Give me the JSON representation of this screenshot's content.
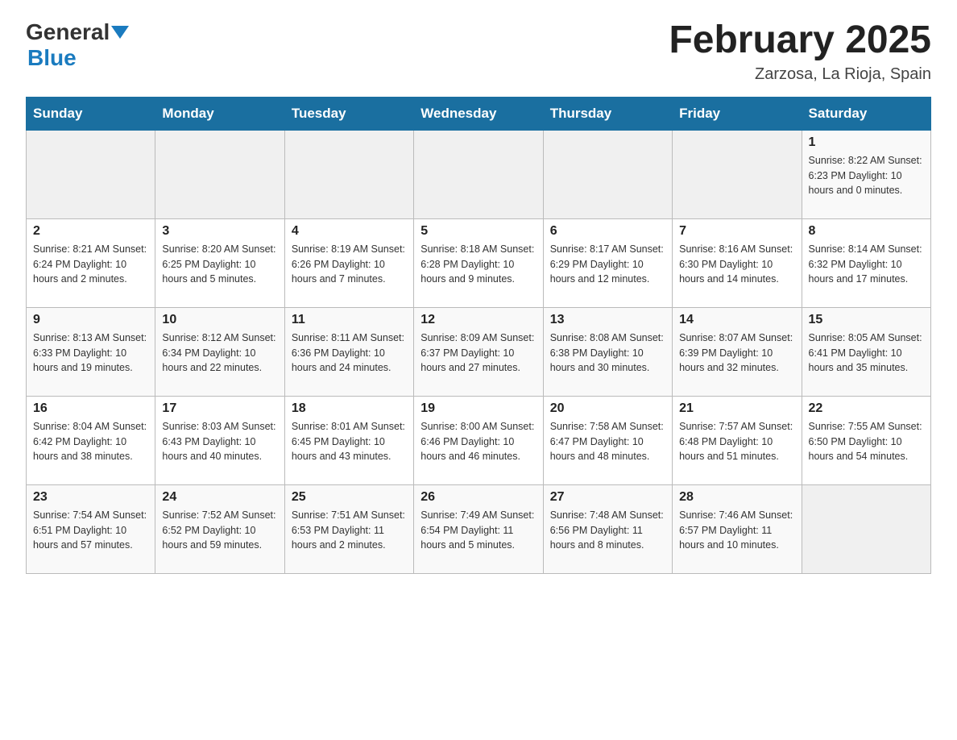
{
  "header": {
    "logo_general": "General",
    "logo_blue": "Blue",
    "title": "February 2025",
    "subtitle": "Zarzosa, La Rioja, Spain"
  },
  "weekdays": [
    "Sunday",
    "Monday",
    "Tuesday",
    "Wednesday",
    "Thursday",
    "Friday",
    "Saturday"
  ],
  "weeks": [
    [
      {
        "day": "",
        "info": ""
      },
      {
        "day": "",
        "info": ""
      },
      {
        "day": "",
        "info": ""
      },
      {
        "day": "",
        "info": ""
      },
      {
        "day": "",
        "info": ""
      },
      {
        "day": "",
        "info": ""
      },
      {
        "day": "1",
        "info": "Sunrise: 8:22 AM\nSunset: 6:23 PM\nDaylight: 10 hours\nand 0 minutes."
      }
    ],
    [
      {
        "day": "2",
        "info": "Sunrise: 8:21 AM\nSunset: 6:24 PM\nDaylight: 10 hours\nand 2 minutes."
      },
      {
        "day": "3",
        "info": "Sunrise: 8:20 AM\nSunset: 6:25 PM\nDaylight: 10 hours\nand 5 minutes."
      },
      {
        "day": "4",
        "info": "Sunrise: 8:19 AM\nSunset: 6:26 PM\nDaylight: 10 hours\nand 7 minutes."
      },
      {
        "day": "5",
        "info": "Sunrise: 8:18 AM\nSunset: 6:28 PM\nDaylight: 10 hours\nand 9 minutes."
      },
      {
        "day": "6",
        "info": "Sunrise: 8:17 AM\nSunset: 6:29 PM\nDaylight: 10 hours\nand 12 minutes."
      },
      {
        "day": "7",
        "info": "Sunrise: 8:16 AM\nSunset: 6:30 PM\nDaylight: 10 hours\nand 14 minutes."
      },
      {
        "day": "8",
        "info": "Sunrise: 8:14 AM\nSunset: 6:32 PM\nDaylight: 10 hours\nand 17 minutes."
      }
    ],
    [
      {
        "day": "9",
        "info": "Sunrise: 8:13 AM\nSunset: 6:33 PM\nDaylight: 10 hours\nand 19 minutes."
      },
      {
        "day": "10",
        "info": "Sunrise: 8:12 AM\nSunset: 6:34 PM\nDaylight: 10 hours\nand 22 minutes."
      },
      {
        "day": "11",
        "info": "Sunrise: 8:11 AM\nSunset: 6:36 PM\nDaylight: 10 hours\nand 24 minutes."
      },
      {
        "day": "12",
        "info": "Sunrise: 8:09 AM\nSunset: 6:37 PM\nDaylight: 10 hours\nand 27 minutes."
      },
      {
        "day": "13",
        "info": "Sunrise: 8:08 AM\nSunset: 6:38 PM\nDaylight: 10 hours\nand 30 minutes."
      },
      {
        "day": "14",
        "info": "Sunrise: 8:07 AM\nSunset: 6:39 PM\nDaylight: 10 hours\nand 32 minutes."
      },
      {
        "day": "15",
        "info": "Sunrise: 8:05 AM\nSunset: 6:41 PM\nDaylight: 10 hours\nand 35 minutes."
      }
    ],
    [
      {
        "day": "16",
        "info": "Sunrise: 8:04 AM\nSunset: 6:42 PM\nDaylight: 10 hours\nand 38 minutes."
      },
      {
        "day": "17",
        "info": "Sunrise: 8:03 AM\nSunset: 6:43 PM\nDaylight: 10 hours\nand 40 minutes."
      },
      {
        "day": "18",
        "info": "Sunrise: 8:01 AM\nSunset: 6:45 PM\nDaylight: 10 hours\nand 43 minutes."
      },
      {
        "day": "19",
        "info": "Sunrise: 8:00 AM\nSunset: 6:46 PM\nDaylight: 10 hours\nand 46 minutes."
      },
      {
        "day": "20",
        "info": "Sunrise: 7:58 AM\nSunset: 6:47 PM\nDaylight: 10 hours\nand 48 minutes."
      },
      {
        "day": "21",
        "info": "Sunrise: 7:57 AM\nSunset: 6:48 PM\nDaylight: 10 hours\nand 51 minutes."
      },
      {
        "day": "22",
        "info": "Sunrise: 7:55 AM\nSunset: 6:50 PM\nDaylight: 10 hours\nand 54 minutes."
      }
    ],
    [
      {
        "day": "23",
        "info": "Sunrise: 7:54 AM\nSunset: 6:51 PM\nDaylight: 10 hours\nand 57 minutes."
      },
      {
        "day": "24",
        "info": "Sunrise: 7:52 AM\nSunset: 6:52 PM\nDaylight: 10 hours\nand 59 minutes."
      },
      {
        "day": "25",
        "info": "Sunrise: 7:51 AM\nSunset: 6:53 PM\nDaylight: 11 hours\nand 2 minutes."
      },
      {
        "day": "26",
        "info": "Sunrise: 7:49 AM\nSunset: 6:54 PM\nDaylight: 11 hours\nand 5 minutes."
      },
      {
        "day": "27",
        "info": "Sunrise: 7:48 AM\nSunset: 6:56 PM\nDaylight: 11 hours\nand 8 minutes."
      },
      {
        "day": "28",
        "info": "Sunrise: 7:46 AM\nSunset: 6:57 PM\nDaylight: 11 hours\nand 10 minutes."
      },
      {
        "day": "",
        "info": ""
      }
    ]
  ]
}
